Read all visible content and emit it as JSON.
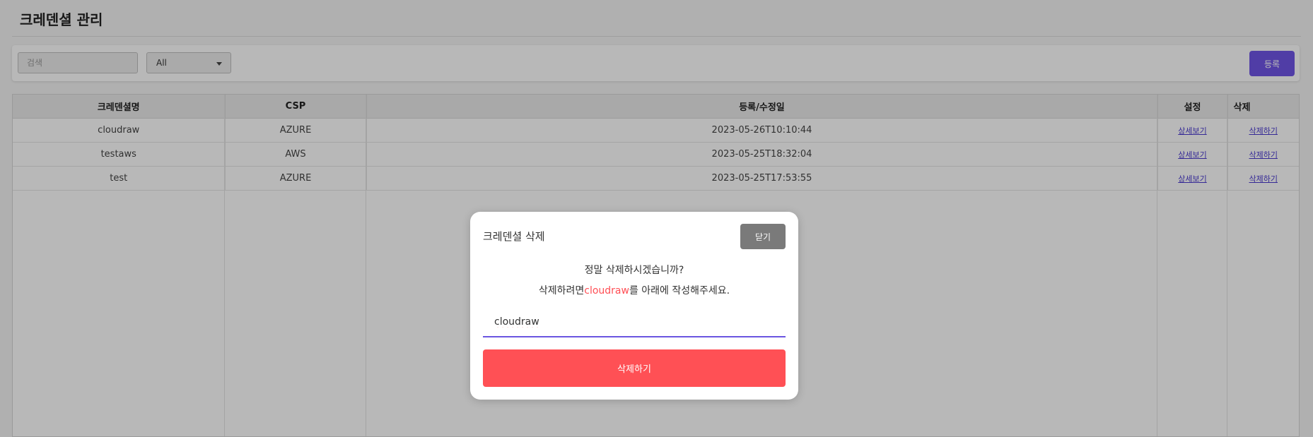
{
  "page": {
    "title": "크레덴셜 관리"
  },
  "toolbar": {
    "search_placeholder": "검색",
    "csp_filter": {
      "selected": "All"
    },
    "register_label": "등록"
  },
  "table": {
    "headers": [
      "크레덴셜명",
      "CSP",
      "등록/수정일",
      "설정",
      "삭제"
    ],
    "rows": [
      {
        "name": "cloudraw",
        "csp": "AZURE",
        "date": "2023-05-26T10:10:44",
        "settings": "상세보기",
        "delete": "삭제하기"
      },
      {
        "name": "testaws",
        "csp": "AWS",
        "date": "2023-05-25T18:32:04",
        "settings": "상세보기",
        "delete": "삭제하기"
      },
      {
        "name": "test",
        "csp": "AZURE",
        "date": "2023-05-25T17:53:55",
        "settings": "상세보기",
        "delete": "삭제하기"
      }
    ]
  },
  "modal": {
    "title": "크레덴셜 삭제",
    "close_label": "닫기",
    "question": "정말 삭제하시겠습니까?",
    "instruction_prefix": "삭제하려면",
    "instruction_target": "cloudraw",
    "instruction_suffix": "를 아래에 작성해주세요.",
    "input_value": "cloudraw",
    "confirm_label": "삭제하기"
  },
  "colors": {
    "accent": "#6f55e6",
    "danger": "#ff5055",
    "close_button": "#7a7a7a"
  }
}
